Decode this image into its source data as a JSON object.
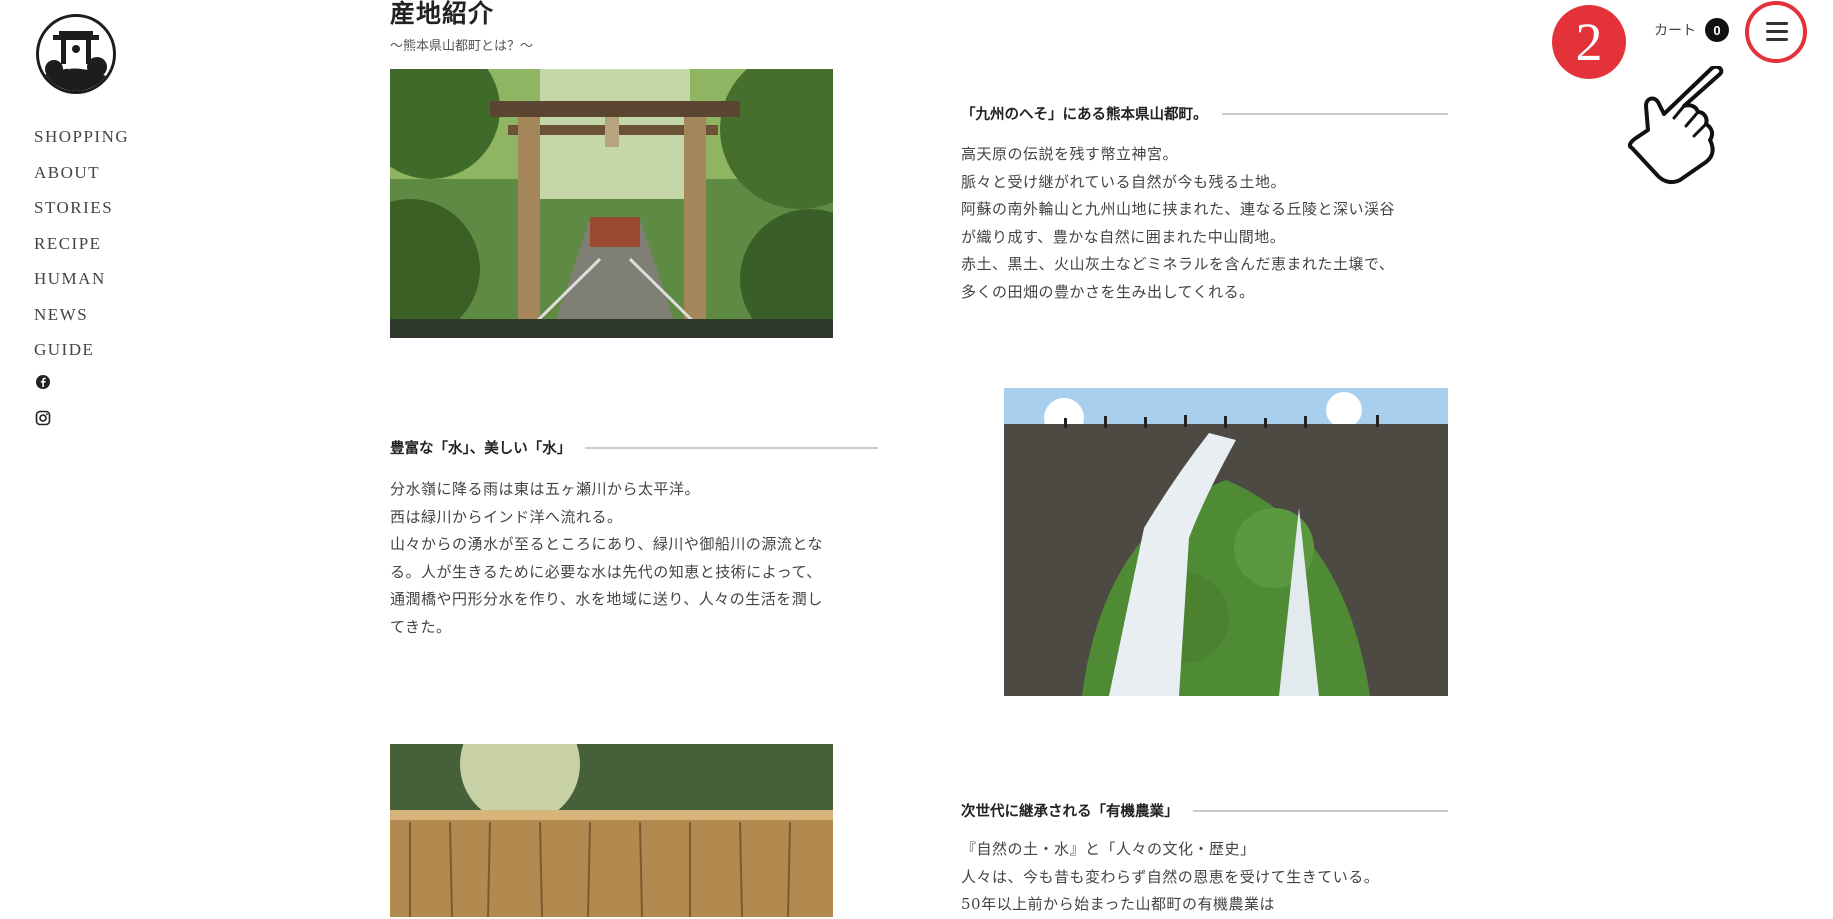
{
  "sidebar": {
    "nav": [
      "SHOPPING",
      "ABOUT",
      "STORIES",
      "RECIPE",
      "HUMAN",
      "NEWS",
      "GUIDE"
    ],
    "social_icons": [
      "facebook-icon",
      "instagram-icon"
    ]
  },
  "header": {
    "step_number": "2",
    "cart_label": "カート",
    "cart_count": "0",
    "menu_icon": "hamburger-icon",
    "pointer_icon": "pointing-hand-icon"
  },
  "page": {
    "title": "産地紹介",
    "subtitle": "〜熊本県山都町とは？〜"
  },
  "sections": [
    {
      "title": "「九州のへそ」にある熊本県山都町。",
      "lines": [
        "高天原の伝説を残す幣立神宮。",
        "脈々と受け継がれている自然が今も残る土地。",
        "阿蘇の南外輪山と九州山地に挟まれた、連なる丘陵と深い渓谷",
        "が織り成す、豊かな自然に囲まれた中山間地。",
        "赤土、黒土、火山灰土などミネラルを含んだ恵まれた土壌で、",
        "多くの田畑の豊かさを生み出してくれる。"
      ]
    },
    {
      "title": "豊富な「水」、美しい「水」",
      "lines": [
        "分水嶺に降る雨は東は五ヶ瀬川から太平洋。",
        "西は緑川からインド洋へ流れる。",
        "山々からの湧水が至るところにあり、緑川や御船川の源流とな",
        "る。人が生きるために必要な水は先代の知恵と技術によって、",
        "通潤橋や円形分水を作り、水を地域に送り、人々の生活を潤し",
        "てきた。"
      ]
    },
    {
      "title": "次世代に継承される「有機農業」",
      "lines": [
        "『自然の土・水』と「人々の文化・歴史」",
        "人々は、今も昔も変わらず自然の恩恵を受けて生きている。",
        "50年以上前から始まった山都町の有機農業は"
      ]
    }
  ],
  "colors": {
    "accent": "#e4323a",
    "text": "#333333",
    "rule": "#cccccc"
  }
}
